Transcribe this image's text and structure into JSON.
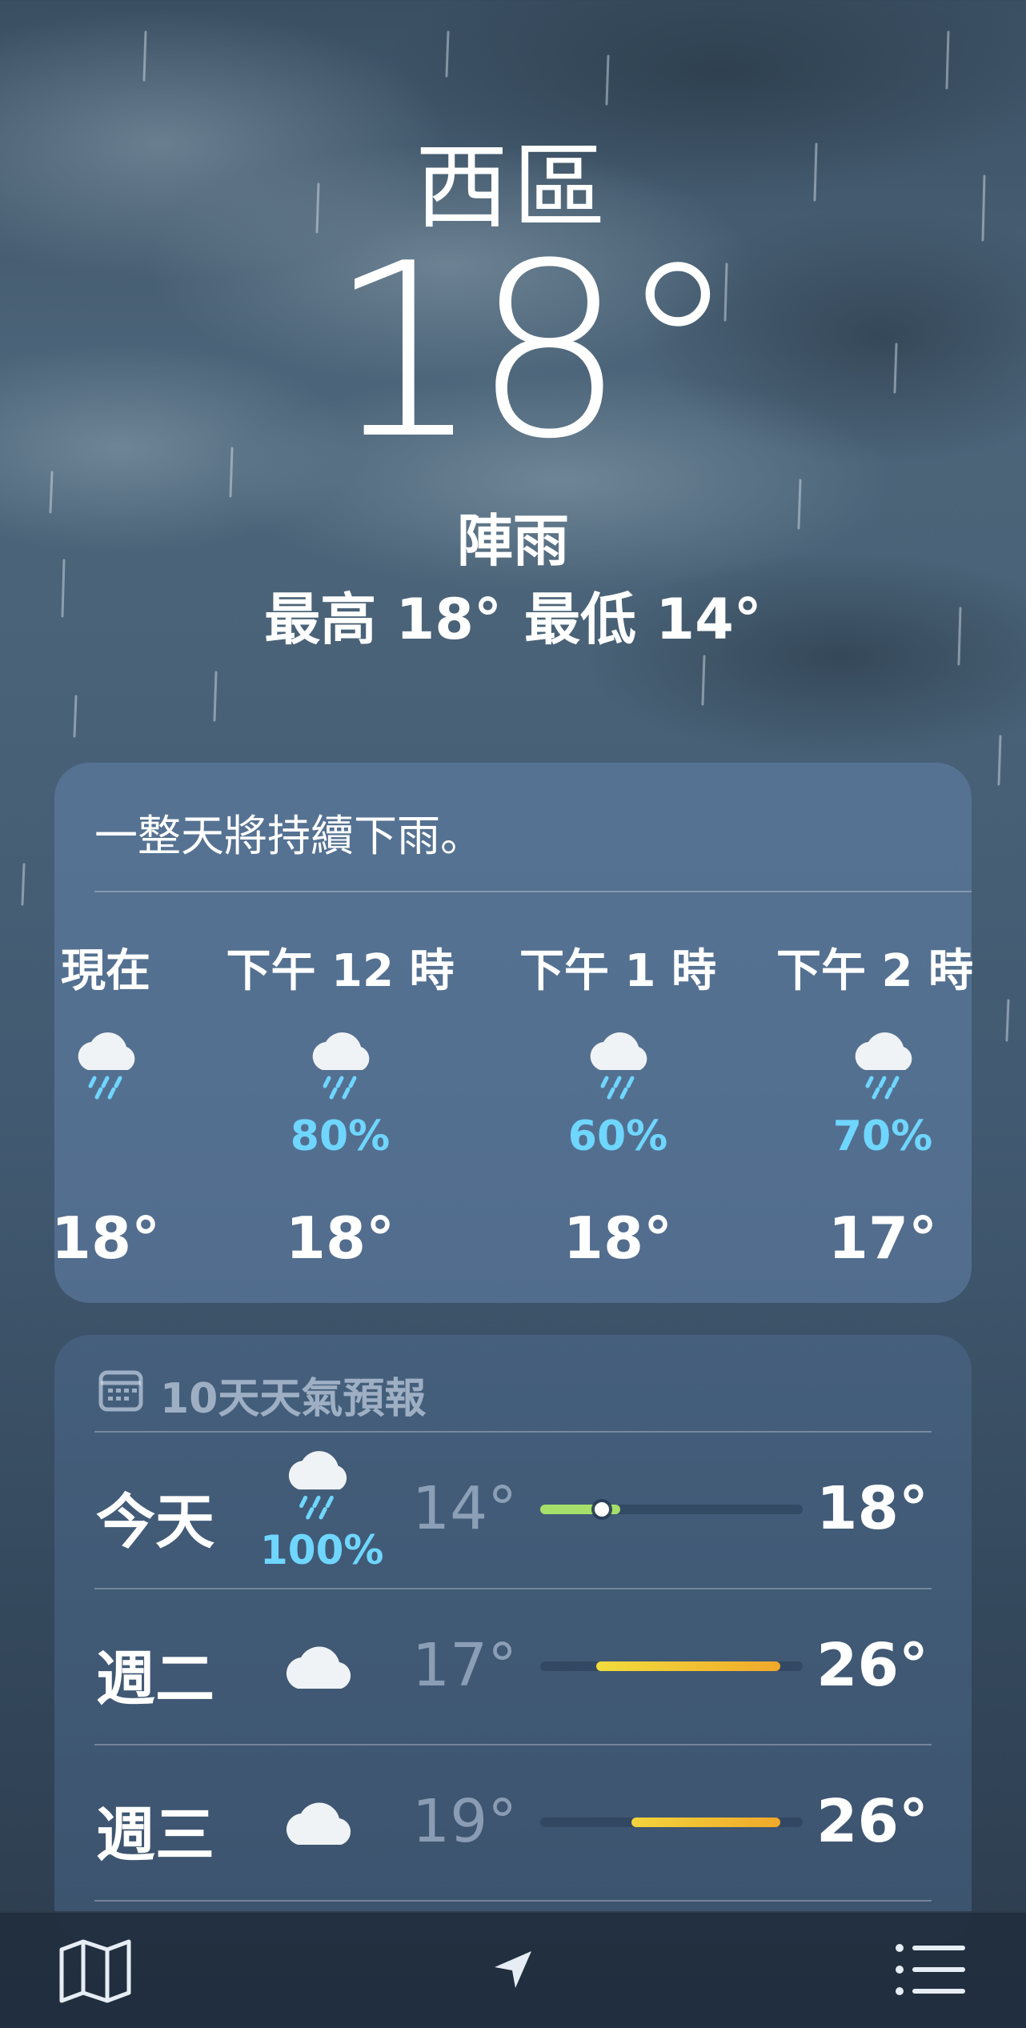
{
  "location": {
    "city": "西區",
    "temperature": "18°",
    "condition": "陣雨",
    "high": "最高 18°",
    "low": "最低 14°"
  },
  "hourly": {
    "summary": "一整天將持續下雨。",
    "items": [
      {
        "time": "現在",
        "icon": "rain-cloud-icon",
        "pop": "",
        "temp": "18°"
      },
      {
        "time": "下午 12 時",
        "icon": "rain-cloud-icon",
        "pop": "80%",
        "temp": "18°"
      },
      {
        "time": "下午 1 時",
        "icon": "rain-cloud-icon",
        "pop": "60%",
        "temp": "18°"
      },
      {
        "time": "下午 2 時",
        "icon": "rain-cloud-icon",
        "pop": "70%",
        "temp": "17°"
      }
    ]
  },
  "forecast": {
    "title": "10天天氣預報",
    "rows": [
      {
        "day": "今天",
        "icon": "rain-cloud-icon",
        "pop": "100%",
        "low": "14°",
        "high": "18°",
        "current_marker": true
      },
      {
        "day": "週二",
        "icon": "cloud-icon",
        "pop": "",
        "low": "17°",
        "high": "26°"
      },
      {
        "day": "週三",
        "icon": "cloud-icon",
        "pop": "",
        "low": "19°",
        "high": "26°"
      }
    ]
  },
  "colors": {
    "precip": "#6fd6ff",
    "bar_cool": "#a6e06a",
    "bar_warm": "#f2cf3c",
    "bar_hot": "#f0a92a"
  },
  "tabbar": {
    "icons": [
      "map-icon",
      "location-arrow-icon",
      "list-icon"
    ]
  }
}
